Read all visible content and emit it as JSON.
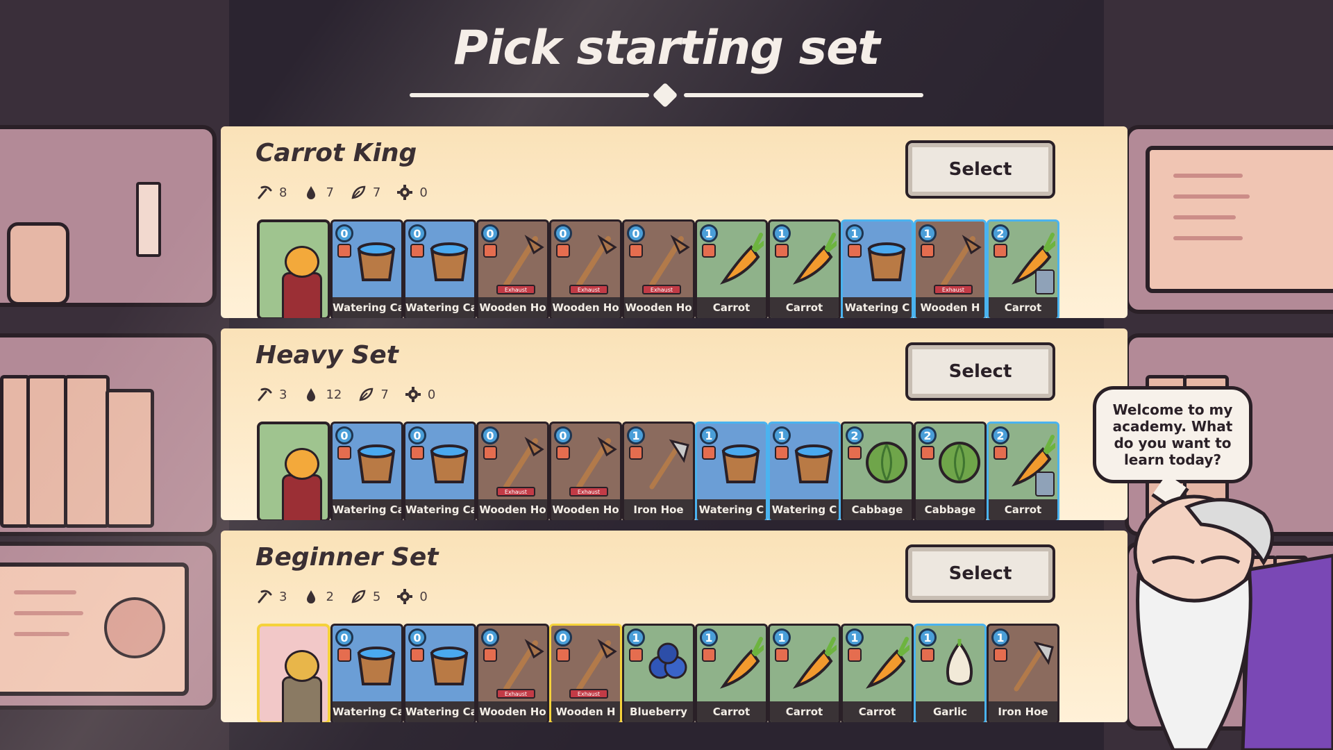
{
  "title": "Pick starting set",
  "colors": {
    "background": "#2b2430",
    "panel": "#fae2b8",
    "card_blue_border": "#4ab3ef",
    "card_yellow_border": "#f5d23a",
    "exhaust_badge": "#c23b46",
    "cost_badge": "#4a9ed8"
  },
  "stat_icons": [
    "pickaxe-icon",
    "water-drop-icon",
    "leaf-icon",
    "gear-icon"
  ],
  "sets": [
    {
      "name": "Carrot King",
      "select_label": "Select",
      "stats": [
        "8",
        "7",
        "7",
        "0"
      ],
      "leader_style": "green",
      "cards": [
        {
          "cost": "0",
          "name": "Watering Ca",
          "art": "bucket",
          "bg": "#6b9ed6",
          "border": "default",
          "exhaust": ""
        },
        {
          "cost": "0",
          "name": "Watering Ca",
          "art": "bucket",
          "bg": "#6b9ed6",
          "border": "default",
          "exhaust": ""
        },
        {
          "cost": "0",
          "name": "Wooden Ho",
          "art": "hoe",
          "bg": "#8b6b5e",
          "border": "default",
          "exhaust": "Exhaust"
        },
        {
          "cost": "0",
          "name": "Wooden Ho",
          "art": "hoe",
          "bg": "#8b6b5e",
          "border": "default",
          "exhaust": "Exhaust"
        },
        {
          "cost": "0",
          "name": "Wooden Ho",
          "art": "hoe",
          "bg": "#8b6b5e",
          "border": "default",
          "exhaust": "Exhaust"
        },
        {
          "cost": "1",
          "name": "Carrot",
          "art": "carrot",
          "bg": "#8fb28a",
          "border": "default",
          "exhaust": ""
        },
        {
          "cost": "1",
          "name": "Carrot",
          "art": "carrot",
          "bg": "#8fb28a",
          "border": "default",
          "exhaust": ""
        },
        {
          "cost": "1",
          "name": "Watering C",
          "art": "bucket",
          "bg": "#6b9ed6",
          "border": "blue",
          "exhaust": ""
        },
        {
          "cost": "1",
          "name": "Wooden H",
          "art": "hoe",
          "bg": "#8b6b5e",
          "border": "blue",
          "exhaust": "Exhaust"
        },
        {
          "cost": "2",
          "name": "Carrot",
          "art": "carrot",
          "bg": "#8fb28a",
          "border": "blue",
          "exhaust": "",
          "bonus": true
        }
      ]
    },
    {
      "name": "Heavy Set",
      "select_label": "Select",
      "stats": [
        "3",
        "12",
        "7",
        "0"
      ],
      "leader_style": "green",
      "cards": [
        {
          "cost": "0",
          "name": "Watering Ca",
          "art": "bucket",
          "bg": "#6b9ed6",
          "border": "default",
          "exhaust": ""
        },
        {
          "cost": "0",
          "name": "Watering Ca",
          "art": "bucket",
          "bg": "#6b9ed6",
          "border": "default",
          "exhaust": ""
        },
        {
          "cost": "0",
          "name": "Wooden Ho",
          "art": "hoe",
          "bg": "#8b6b5e",
          "border": "default",
          "exhaust": "Exhaust"
        },
        {
          "cost": "0",
          "name": "Wooden Ho",
          "art": "hoe",
          "bg": "#8b6b5e",
          "border": "default",
          "exhaust": "Exhaust"
        },
        {
          "cost": "1",
          "name": "Iron Hoe",
          "art": "ironhoe",
          "bg": "#8b6b5e",
          "border": "default",
          "exhaust": ""
        },
        {
          "cost": "1",
          "name": "Watering C",
          "art": "bucket",
          "bg": "#6b9ed6",
          "border": "blue",
          "exhaust": ""
        },
        {
          "cost": "1",
          "name": "Watering C",
          "art": "bucket",
          "bg": "#6b9ed6",
          "border": "blue",
          "exhaust": ""
        },
        {
          "cost": "2",
          "name": "Cabbage",
          "art": "cabbage",
          "bg": "#8fb28a",
          "border": "default",
          "exhaust": ""
        },
        {
          "cost": "2",
          "name": "Cabbage",
          "art": "cabbage",
          "bg": "#8fb28a",
          "border": "default",
          "exhaust": ""
        },
        {
          "cost": "2",
          "name": "Carrot",
          "art": "carrot",
          "bg": "#8fb28a",
          "border": "blue",
          "exhaust": "",
          "bonus": true
        }
      ]
    },
    {
      "name": "Beginner Set",
      "select_label": "Select",
      "stats": [
        "3",
        "2",
        "5",
        "0"
      ],
      "leader_style": "yellow",
      "cards": [
        {
          "cost": "0",
          "name": "Watering Ca",
          "art": "bucket",
          "bg": "#6b9ed6",
          "border": "default",
          "exhaust": ""
        },
        {
          "cost": "0",
          "name": "Watering Ca",
          "art": "bucket",
          "bg": "#6b9ed6",
          "border": "default",
          "exhaust": ""
        },
        {
          "cost": "0",
          "name": "Wooden Ho",
          "art": "hoe",
          "bg": "#8b6b5e",
          "border": "default",
          "exhaust": "Exhaust"
        },
        {
          "cost": "0",
          "name": "Wooden H",
          "art": "hoe",
          "bg": "#8b6b5e",
          "border": "yellow",
          "exhaust": "Exhaust"
        },
        {
          "cost": "1",
          "name": "Blueberry",
          "art": "blueberry",
          "bg": "#8fb28a",
          "border": "default",
          "exhaust": ""
        },
        {
          "cost": "1",
          "name": "Carrot",
          "art": "carrot",
          "bg": "#8fb28a",
          "border": "default",
          "exhaust": ""
        },
        {
          "cost": "1",
          "name": "Carrot",
          "art": "carrot",
          "bg": "#8fb28a",
          "border": "default",
          "exhaust": ""
        },
        {
          "cost": "1",
          "name": "Carrot",
          "art": "carrot",
          "bg": "#8fb28a",
          "border": "default",
          "exhaust": ""
        },
        {
          "cost": "1",
          "name": "Garlic",
          "art": "garlic",
          "bg": "#8fb28a",
          "border": "blue",
          "exhaust": ""
        },
        {
          "cost": "1",
          "name": "Iron Hoe",
          "art": "ironhoe",
          "bg": "#8b6b5e",
          "border": "default",
          "exhaust": ""
        }
      ]
    }
  ],
  "mentor": {
    "speech": "Welcome to my academy. What do you want to learn today?"
  }
}
